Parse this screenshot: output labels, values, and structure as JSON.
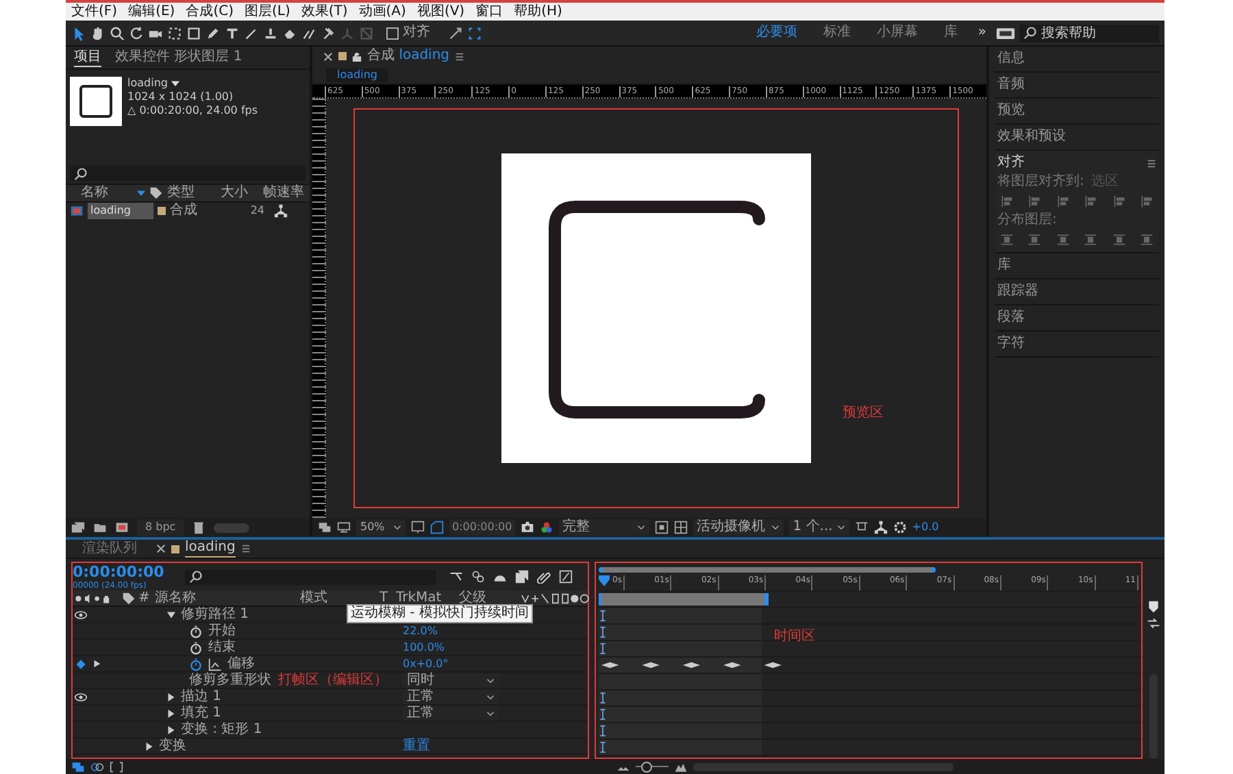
{
  "menu": [
    "文件(F)",
    "编辑(E)",
    "合成(C)",
    "图层(L)",
    "效果(T)",
    "动画(A)",
    "视图(V)",
    "窗口",
    "帮助(H)"
  ],
  "toolbar": {
    "snap_label": "对齐",
    "snap_checked": false,
    "workspaces": [
      {
        "label": "必要项",
        "selected": true
      },
      {
        "label": "标准",
        "selected": false
      },
      {
        "label": "小屏幕",
        "selected": false
      },
      {
        "label": "库",
        "selected": false
      }
    ],
    "more": "»",
    "search_placeholder": "搜索帮助"
  },
  "project_panel": {
    "tabs": [
      {
        "label": "项目",
        "selected": true
      },
      {
        "label": "效果控件 形状图层 1",
        "selected": false
      }
    ],
    "preview_name": "loading",
    "preview_size": "1024 x 1024 (1.00)",
    "preview_duration": "△ 0:00:20:00, 24.00 fps",
    "columns": [
      "名称",
      "类型",
      "大小",
      "帧速率"
    ],
    "items": [
      {
        "name": "loading",
        "type": "合成",
        "fps": "24",
        "selected": true
      }
    ],
    "bpc": "8 bpc"
  },
  "composition": {
    "tab_prefix": "合成",
    "tab_name": "loading",
    "breadcrumb": "loading",
    "ruler": [
      "625",
      "500",
      "375",
      "250",
      "125",
      "0",
      "125",
      "250",
      "375",
      "500",
      "625",
      "750",
      "875",
      "1000",
      "1125",
      "1250",
      "1375",
      "1500"
    ],
    "annotation": "预览区",
    "footer": {
      "zoom": "50%",
      "time": "0:00:00:00",
      "resolution": "完整",
      "camera": "活动摄像机",
      "views": "1 个...",
      "exposure": "+0.0"
    }
  },
  "right_panels": [
    {
      "label": "信息",
      "kind": "collapsed"
    },
    {
      "label": "音频",
      "kind": "collapsed"
    },
    {
      "label": "预览",
      "kind": "collapsed"
    },
    {
      "label": "效果和预设",
      "kind": "collapsed"
    },
    {
      "label": "对齐",
      "kind": "expanded"
    },
    {
      "label": "库",
      "kind": "collapsed"
    },
    {
      "label": "跟踪器",
      "kind": "collapsed"
    },
    {
      "label": "段落",
      "kind": "collapsed"
    },
    {
      "label": "字符",
      "kind": "collapsed"
    }
  ],
  "align": {
    "align_to_label": "将图层对齐到:",
    "align_to_value": "选区",
    "distribute_label": "分布图层:"
  },
  "timeline": {
    "tabs": [
      {
        "label": "渲染队列",
        "selected": false
      },
      {
        "label": "loading",
        "selected": true
      }
    ],
    "timecode": "0:00:00:00",
    "frame_info": "00000 (24.00 fps)",
    "columns": [
      "#",
      "源名称",
      "模式",
      "T",
      "TrkMat",
      "父级"
    ],
    "tooltip": "运动模糊 - 模拟快门持续时间",
    "edit_annotation": "打帧区（编辑区）",
    "time_annotation": "时间区",
    "time_ruler": [
      "0s",
      "01s",
      "02s",
      "03s",
      "04s",
      "05s",
      "06s",
      "07s",
      "08s",
      "09s",
      "10s",
      "11"
    ],
    "zoom": {
      "level": 0.35
    },
    "shape_properties": [
      {
        "kind": "group",
        "name": "修剪路径 1",
        "expanded": true,
        "eye": true,
        "children": [
          {
            "kind": "property",
            "name": "开始",
            "value": "22.0%",
            "animated": false
          },
          {
            "kind": "property",
            "name": "结束",
            "value": "100.0%",
            "animated": false
          },
          {
            "kind": "property",
            "name": "偏移",
            "value": "0x+0.0°",
            "animated": true
          },
          {
            "kind": "option",
            "name": "修剪多重形状",
            "value": "同时"
          }
        ]
      },
      {
        "kind": "group",
        "name": "描边 1",
        "expanded": false,
        "eye": true,
        "mode": "正常"
      },
      {
        "kind": "group",
        "name": "填充 1",
        "expanded": false,
        "eye": false,
        "mode": "正常"
      },
      {
        "kind": "group",
        "name": "变换 : 矩形 1",
        "expanded": false,
        "eye": false
      }
    ],
    "layer_properties": [
      {
        "kind": "group",
        "name": "变换",
        "expanded": false,
        "eye": false,
        "link": "重置"
      }
    ]
  }
}
